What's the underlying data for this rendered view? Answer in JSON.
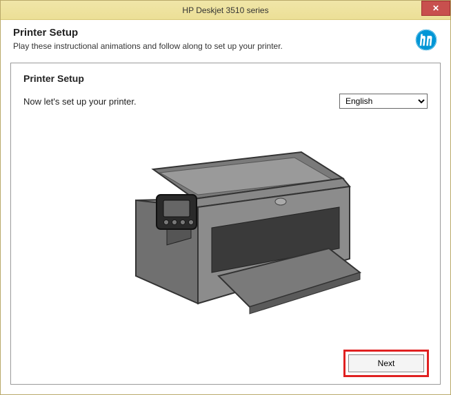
{
  "titlebar": {
    "text": "HP Deskjet 3510 series",
    "close": "✕"
  },
  "header": {
    "title": "Printer Setup",
    "subtitle": "Play these instructional animations and follow along to set up your printer."
  },
  "content": {
    "title": "Printer Setup",
    "subtitle": "Now let's set up your printer.",
    "language": "English"
  },
  "footer": {
    "next": "Next"
  },
  "brand": {
    "name": "hp"
  }
}
